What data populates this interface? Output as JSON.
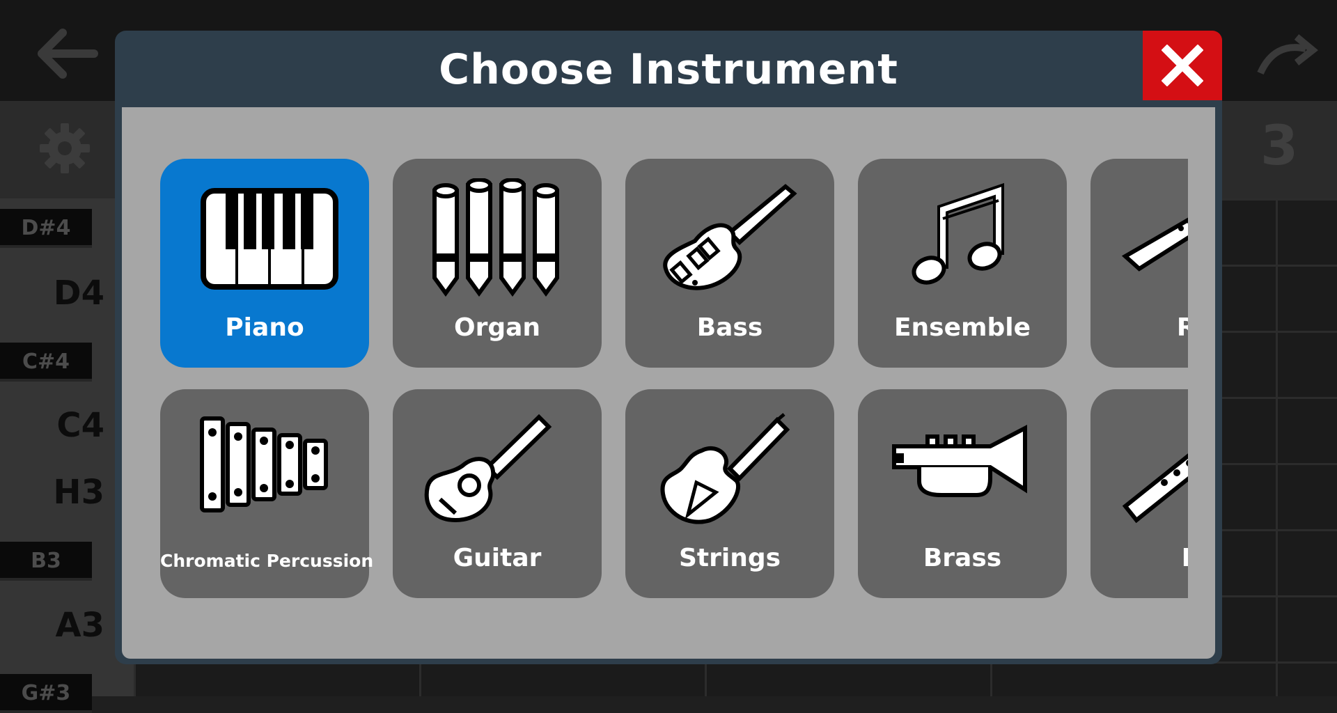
{
  "background": {
    "measure_number": "3",
    "keys": {
      "d_sharp_4": "D#4",
      "d4": "D4",
      "c_sharp_4": "C#4",
      "c4": "C4",
      "h3": "H3",
      "b3": "B3",
      "a3": "A3",
      "g_sharp_3": "G#3"
    }
  },
  "modal": {
    "title": "Choose Instrument",
    "close_icon": "close-icon"
  },
  "instruments": [
    {
      "label": "Piano",
      "icon": "piano-icon",
      "selected": true
    },
    {
      "label": "Organ",
      "icon": "organ-icon"
    },
    {
      "label": "Bass",
      "icon": "bass-guitar-icon"
    },
    {
      "label": "Ensemble",
      "icon": "music-note-icon"
    },
    {
      "label": "Re",
      "icon": "reed-icon"
    },
    {
      "label": "Chromatic Percussion",
      "icon": "xylophone-icon"
    },
    {
      "label": "Guitar",
      "icon": "guitar-icon"
    },
    {
      "label": "Strings",
      "icon": "violin-icon"
    },
    {
      "label": "Brass",
      "icon": "trumpet-icon"
    },
    {
      "label": "Pi",
      "icon": "pipe-icon"
    }
  ],
  "colors": {
    "selected_tile": "#0878cf",
    "tile": "#646464",
    "modal_header": "#2e3e4b",
    "close_button": "#d40f14"
  }
}
